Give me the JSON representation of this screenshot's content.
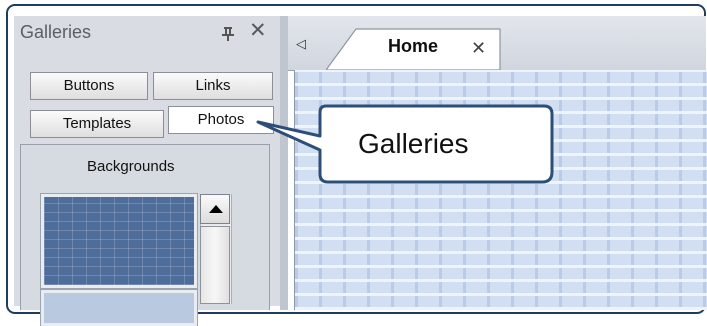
{
  "panel": {
    "title": "Galleries",
    "pin_icon": "pin-icon",
    "close_glyph": "✕",
    "tabs": [
      {
        "label": "Buttons"
      },
      {
        "label": "Links"
      },
      {
        "label": "Templates"
      },
      {
        "label": "Photos"
      }
    ],
    "section_title": "Backgrounds"
  },
  "document": {
    "nav_glyph": "◁",
    "tab_label": "Home",
    "tab_close": "✕"
  },
  "callout": {
    "text": "Galleries"
  },
  "colors": {
    "frame_border": "#1e3e5f",
    "panel_bg": "#d9dde3",
    "workspace_tile": "#d2dff2"
  }
}
